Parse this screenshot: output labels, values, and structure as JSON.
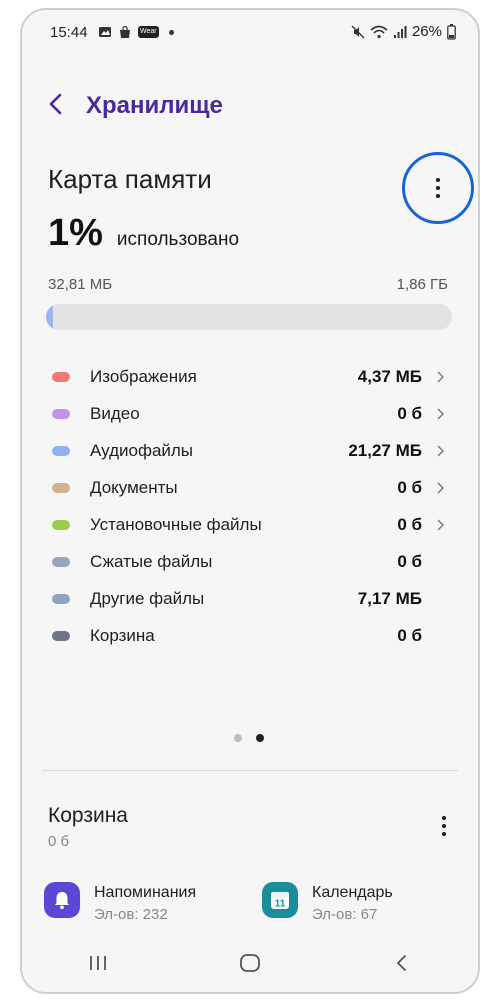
{
  "status_bar": {
    "time": "15:44",
    "wear_badge": "Wear",
    "battery": "26%"
  },
  "header": {
    "title": "Хранилище"
  },
  "card": {
    "title": "Карта памяти",
    "used_percent": "1%",
    "used_label": "использовано",
    "used_amount": "32,81 МБ",
    "total_amount": "1,86 ГБ",
    "used_fraction": 0.017,
    "bar_color": "#9ab6ec"
  },
  "categories": [
    {
      "label": "Изображения",
      "value": "4,37 МБ",
      "color": "#ef7b76",
      "has_chevron": true
    },
    {
      "label": "Видео",
      "value": "0 б",
      "color": "#c490ec",
      "has_chevron": true
    },
    {
      "label": "Аудиофайлы",
      "value": "21,27 МБ",
      "color": "#8fb1f2",
      "has_chevron": true
    },
    {
      "label": "Документы",
      "value": "0 б",
      "color": "#cfb48c",
      "has_chevron": true
    },
    {
      "label": "Установочные файлы",
      "value": "0 б",
      "color": "#98d04a",
      "has_chevron": true
    },
    {
      "label": "Сжатые файлы",
      "value": "0 б",
      "color": "#94a6b8",
      "has_chevron": false
    },
    {
      "label": "Другие файлы",
      "value": "7,17 МБ",
      "color": "#8ea4bd",
      "has_chevron": false
    },
    {
      "label": "Корзина",
      "value": "0 б",
      "color": "#6f7482",
      "has_chevron": false
    }
  ],
  "pager": {
    "pages": 2,
    "active": 1
  },
  "recycle_bin": {
    "title": "Корзина",
    "size": "0 б"
  },
  "apps": [
    {
      "name": "Напоминания",
      "count": "Эл-ов: 232",
      "icon": "bell-icon",
      "color": "#5b47d6"
    },
    {
      "name": "Календарь",
      "count": "Эл-ов: 67",
      "icon": "calendar-icon",
      "color": "#1b8c9a",
      "day": "11"
    }
  ]
}
